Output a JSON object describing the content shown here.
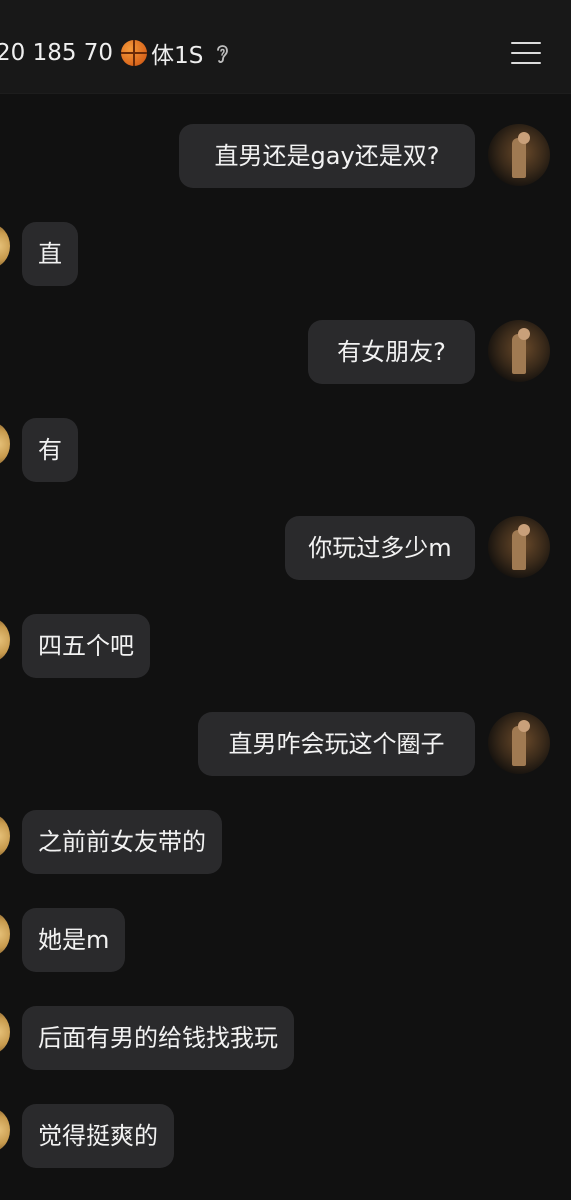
{
  "header": {
    "title_prefix": "20 185 70",
    "title_suffix": "体1S",
    "icons": {
      "ball": "basketball-icon",
      "ear": "ear-icon",
      "menu": "menu-icon"
    }
  },
  "messages": [
    {
      "side": "right",
      "text": "直男还是gay还是双?"
    },
    {
      "side": "left",
      "text": "直"
    },
    {
      "side": "right",
      "text": "有女朋友?"
    },
    {
      "side": "left",
      "text": "有"
    },
    {
      "side": "right",
      "text": "你玩过多少m"
    },
    {
      "side": "left",
      "text": "四五个吧"
    },
    {
      "side": "right",
      "text": "直男咋会玩这个圈子"
    },
    {
      "side": "left",
      "text": "之前前女友带的"
    },
    {
      "side": "left",
      "text": "她是m"
    },
    {
      "side": "left",
      "text": "后面有男的给钱找我玩"
    },
    {
      "side": "left",
      "text": "觉得挺爽的"
    }
  ],
  "colors": {
    "background": "#111111",
    "header": "#181818",
    "bubble": "#2a2a2c",
    "text": "#f2f2f2"
  }
}
